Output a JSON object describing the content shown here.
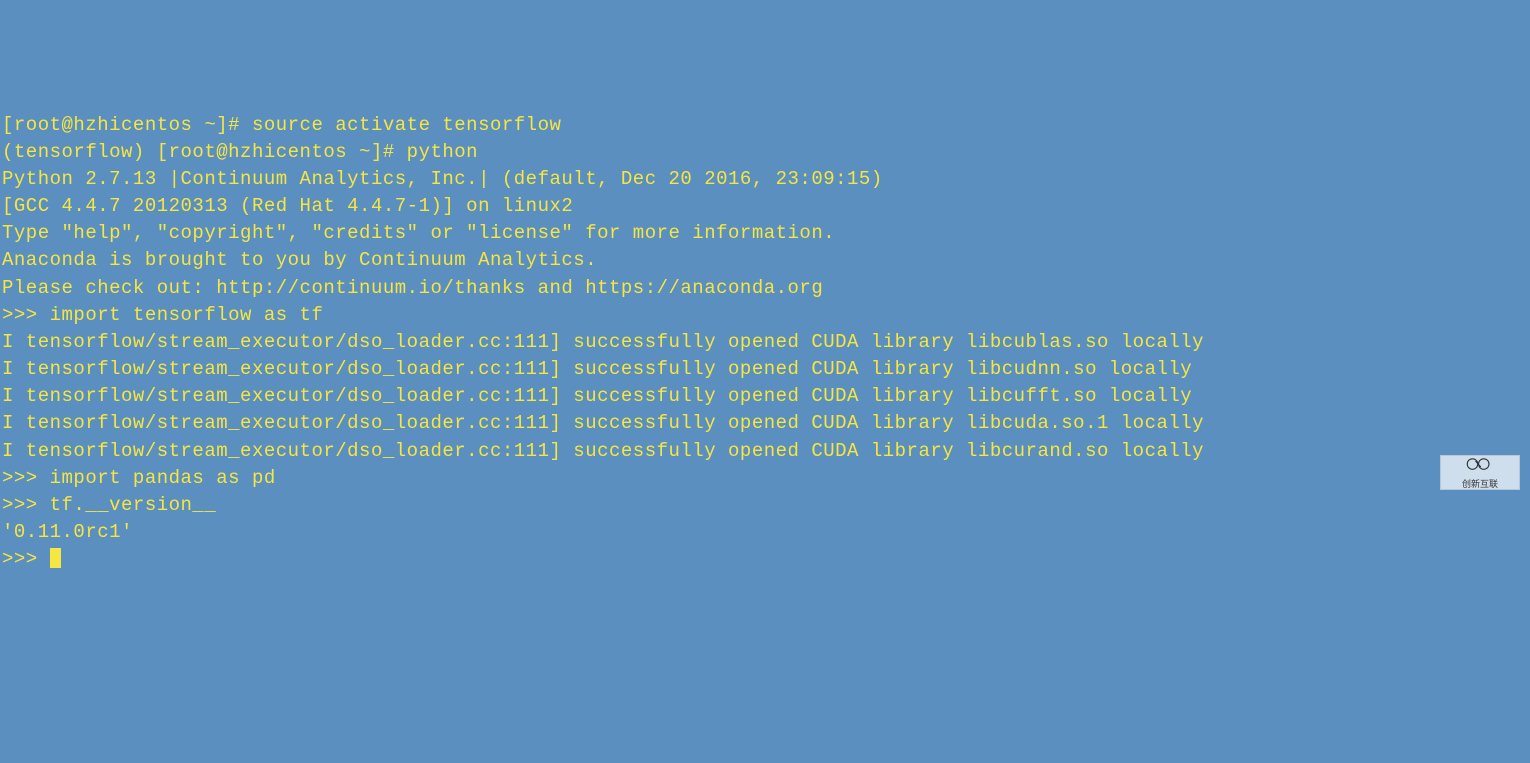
{
  "terminal": {
    "lines": [
      "[root@hzhicentos ~]# source activate tensorflow",
      "(tensorflow) [root@hzhicentos ~]# python",
      "Python 2.7.13 |Continuum Analytics, Inc.| (default, Dec 20 2016, 23:09:15)",
      "[GCC 4.4.7 20120313 (Red Hat 4.4.7-1)] on linux2",
      "Type \"help\", \"copyright\", \"credits\" or \"license\" for more information.",
      "Anaconda is brought to you by Continuum Analytics.",
      "Please check out: http://continuum.io/thanks and https://anaconda.org",
      ">>> import tensorflow as tf",
      "I tensorflow/stream_executor/dso_loader.cc:111] successfully opened CUDA library libcublas.so locally",
      "I tensorflow/stream_executor/dso_loader.cc:111] successfully opened CUDA library libcudnn.so locally",
      "I tensorflow/stream_executor/dso_loader.cc:111] successfully opened CUDA library libcufft.so locally",
      "I tensorflow/stream_executor/dso_loader.cc:111] successfully opened CUDA library libcuda.so.1 locally",
      "I tensorflow/stream_executor/dso_loader.cc:111] successfully opened CUDA library libcurand.so locally",
      ">>> import pandas as pd",
      ">>> tf.__version__",
      "'0.11.0rc1'",
      ">>> "
    ]
  },
  "watermark": {
    "text": "创新互联"
  }
}
